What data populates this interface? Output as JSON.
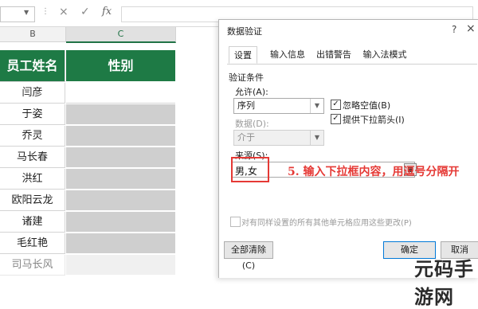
{
  "formula_bar": {
    "cancel_icon": "×",
    "enter_icon": "✓",
    "fx_label": "fx",
    "formula": ""
  },
  "columns": [
    {
      "label": "B",
      "selected": false
    },
    {
      "label": "C",
      "selected": true
    }
  ],
  "table": {
    "header": [
      "员工姓名",
      "性别"
    ],
    "names": [
      "闫彦",
      "于姿",
      "乔灵",
      "马长春",
      "洪红",
      "欧阳云龙",
      "诸建",
      "毛红艳",
      "司马长风"
    ]
  },
  "dialog": {
    "title": "数据验证",
    "help": "?",
    "close": "×",
    "tabs": [
      "设置",
      "输入信息",
      "出错警告",
      "输入法模式"
    ],
    "section_title": "验证条件",
    "allow_label": "允许(A):",
    "allow_value": "序列",
    "ignore_blank": {
      "label": "忽略空值(B)",
      "checked": true
    },
    "dropdown_arrow": {
      "label": "提供下拉箭头(I)",
      "checked": true
    },
    "data_label": "数据(D):",
    "data_value": "介于",
    "source_label": "来源(S):",
    "source_value": "男,女",
    "apply_all": "对有同样设置的所有其他单元格应用这些更改(P)",
    "buttons": {
      "clear_all": "全部清除(C)",
      "ok": "确定",
      "cancel": "取消"
    }
  },
  "annotation": "5. 输入下拉框内容，用逗号分隔开",
  "watermark": "元码手游网",
  "colors": {
    "header_green": "#1e7a45",
    "accent_red": "#e53935",
    "cell_gray": "#cfcfcf"
  }
}
